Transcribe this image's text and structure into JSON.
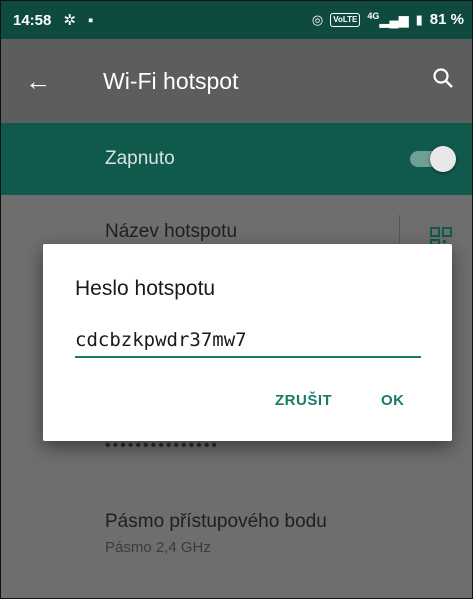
{
  "status_bar": {
    "time": "14:58",
    "icons": [
      "gear-icon",
      "sd-card-icon",
      "hotspot-icon",
      "volte-icon",
      "signal-icon",
      "battery-icon"
    ],
    "volte_label": "VoLTE",
    "network": "4G",
    "battery": "81 %"
  },
  "app_bar": {
    "title": "Wi-Fi hotspot",
    "back_glyph": "←",
    "search_glyph": "⚲"
  },
  "switch": {
    "label": "Zapnuto",
    "state": "on"
  },
  "settings": {
    "hotspot_name_title": "Název hotspotu",
    "password_masked": "•••••••••••••••",
    "band_title": "Pásmo přístupového bodu",
    "band_value": "Pásmo 2,4 GHz"
  },
  "dialog": {
    "title": "Heslo hotspotu",
    "password_value": "cdcbzkpwdr37mw7",
    "cancel_label": "ZRUŠIT",
    "ok_label": "OK"
  },
  "colors": {
    "accent": "#1a7a68",
    "switch_bar": "#0f5a4c",
    "status_bar": "#0e4a3f"
  }
}
